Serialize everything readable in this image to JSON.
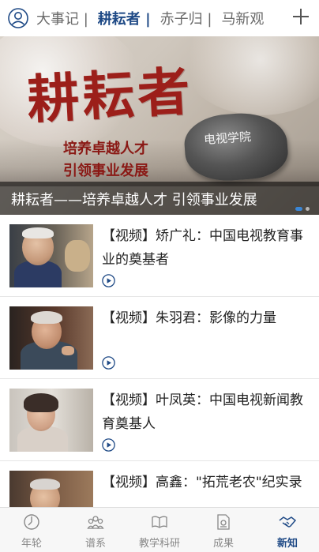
{
  "top_tabs": [
    "大事记 |",
    "耕耘者 |",
    "赤子归 |",
    "马新观"
  ],
  "active_tab_index": 1,
  "banner": {
    "title": "耕耘者",
    "subtitle_line1": "培养卓越人才",
    "subtitle_line2": "引领事业发展",
    "stone_text": "电视学院",
    "caption": "耕耘者——培养卓越人才 引领事业发展",
    "slide_count": 2,
    "active_slide": 1
  },
  "items": [
    {
      "title": "【视频】矫广礼：中国电视教育事业的奠基者",
      "thumb": "elderly-man-portrait"
    },
    {
      "title": "【视频】朱羽君：影像的力量",
      "thumb": "elderly-woman-portrait"
    },
    {
      "title": "【视频】叶凤英：中国电视新闻教育奠基人",
      "thumb": "elderly-woman-portrait"
    },
    {
      "title": "【视频】高鑫：\"拓荒老农\"纪实录",
      "thumb": "elderly-man-portrait"
    }
  ],
  "bottom_nav": [
    {
      "label": "年轮",
      "icon": "growth-ring-icon"
    },
    {
      "label": "谱系",
      "icon": "people-group-icon"
    },
    {
      "label": "教学科研",
      "icon": "open-book-icon"
    },
    {
      "label": "成果",
      "icon": "document-icon"
    },
    {
      "label": "新知",
      "icon": "handshake-icon",
      "active": true
    }
  ],
  "colors": {
    "accent": "#1f4a86",
    "banner_title": "#9c1f1a",
    "play_icon": "#1f4a86"
  }
}
